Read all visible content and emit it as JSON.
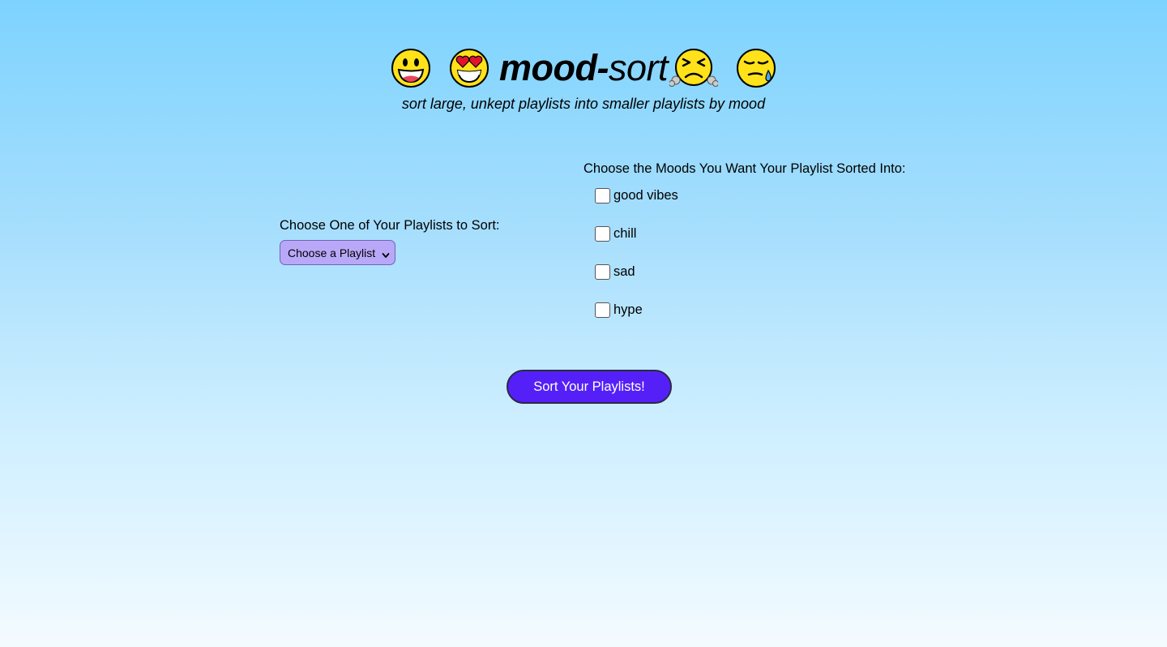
{
  "header": {
    "title_bold": "mood-",
    "title_light": "sort",
    "subtitle": "sort large, unkept playlists into smaller playlists by mood",
    "emojis": [
      "grinning-face-icon",
      "heart-eyes-face-icon",
      "steam-nose-face-icon",
      "sad-sweat-face-icon"
    ]
  },
  "playlist_picker": {
    "label": "Choose One of Your Playlists to Sort:",
    "selected": "Choose a Playlist"
  },
  "moods": {
    "label": "Choose the Moods You Want Your Playlist Sorted Into:",
    "options": [
      {
        "label": "good vibes",
        "checked": false
      },
      {
        "label": "chill",
        "checked": false
      },
      {
        "label": "sad",
        "checked": false
      },
      {
        "label": "hype",
        "checked": false
      }
    ]
  },
  "actions": {
    "sort_label": "Sort Your Playlists!"
  },
  "colors": {
    "button": "#5520f8",
    "select": "#b9a8f8",
    "bg_top": "#7dd3ff",
    "bg_bottom": "#f4fbff",
    "emoji_yellow": "#ffe21a"
  }
}
